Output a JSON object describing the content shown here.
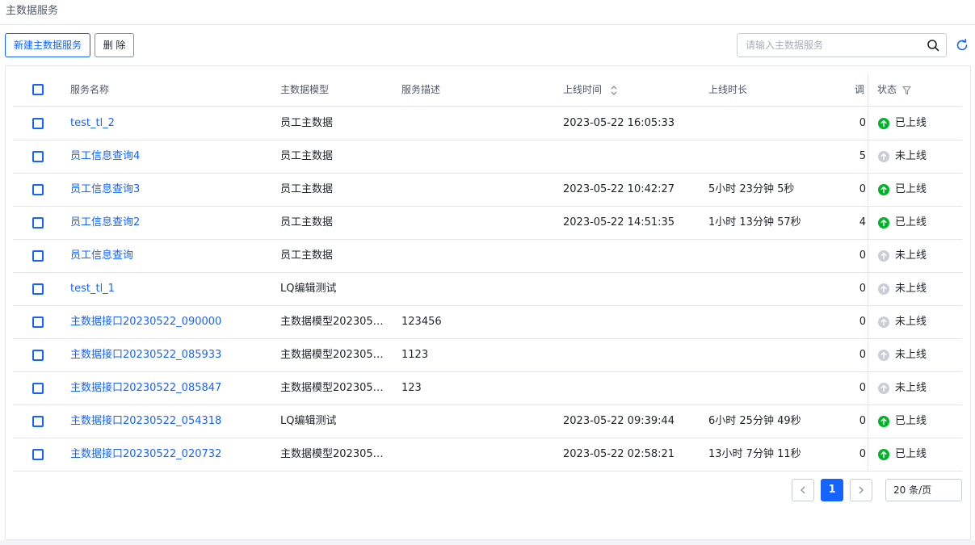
{
  "page": {
    "title": "主数据服务"
  },
  "toolbar": {
    "new_label": "新建主数据服务",
    "delete_label": "删 除"
  },
  "search": {
    "placeholder": "请输入主数据服务",
    "value": ""
  },
  "table": {
    "columns": {
      "name": "服务名称",
      "model": "主数据模型",
      "desc": "服务描述",
      "time": "上线时间",
      "duration": "上线时长",
      "calls": "调用",
      "status": "状态"
    },
    "rows": [
      {
        "name": "test_tl_2",
        "model": "员工主数据",
        "desc": "",
        "time": "2023-05-22 16:05:33",
        "duration": "",
        "calls": "0",
        "status": "已上线",
        "online": true
      },
      {
        "name": "员工信息查询4",
        "model": "员工主数据",
        "desc": "",
        "time": "",
        "duration": "",
        "calls": "5",
        "status": "未上线",
        "online": false
      },
      {
        "name": "员工信息查询3",
        "model": "员工主数据",
        "desc": "",
        "time": "2023-05-22 10:42:27",
        "duration": "5小时 23分钟 5秒",
        "calls": "0",
        "status": "已上线",
        "online": true
      },
      {
        "name": "员工信息查询2",
        "model": "员工主数据",
        "desc": "",
        "time": "2023-05-22 14:51:35",
        "duration": "1小时 13分钟 57秒",
        "calls": "4",
        "status": "已上线",
        "online": true
      },
      {
        "name": "员工信息查询",
        "model": "员工主数据",
        "desc": "",
        "time": "",
        "duration": "",
        "calls": "0",
        "status": "未上线",
        "online": false
      },
      {
        "name": "test_tl_1",
        "model": "LQ编辑测试",
        "desc": "",
        "time": "",
        "duration": "",
        "calls": "0",
        "status": "未上线",
        "online": false
      },
      {
        "name": "主数据接口20230522_090000",
        "model": "主数据模型202305…",
        "desc": "123456",
        "time": "",
        "duration": "",
        "calls": "0",
        "status": "未上线",
        "online": false
      },
      {
        "name": "主数据接口20230522_085933",
        "model": "主数据模型202305…",
        "desc": "1123",
        "time": "",
        "duration": "",
        "calls": "0",
        "status": "未上线",
        "online": false
      },
      {
        "name": "主数据接口20230522_085847",
        "model": "主数据模型202305…",
        "desc": "123",
        "time": "",
        "duration": "",
        "calls": "0",
        "status": "未上线",
        "online": false
      },
      {
        "name": "主数据接口20230522_054318",
        "model": "LQ编辑测试",
        "desc": "",
        "time": "2023-05-22 09:39:44",
        "duration": "6小时 25分钟 49秒",
        "calls": "0",
        "status": "已上线",
        "online": true
      },
      {
        "name": "主数据接口20230522_020732",
        "model": "主数据模型202305…",
        "desc": "",
        "time": "2023-05-22 02:58:21",
        "duration": "13小时 7分钟 11秒",
        "calls": "0",
        "status": "已上线",
        "online": true
      }
    ]
  },
  "pagination": {
    "current_page": "1",
    "page_size_label": "20 条/页"
  },
  "colors": {
    "accent": "#1664ff",
    "online": "#00b42a",
    "offline": "#c9cdd4"
  },
  "icons": {
    "search": "search-icon",
    "refresh": "refresh-icon",
    "sort": "sort-icon",
    "filter": "filter-icon",
    "online": "arrow-up-circle-icon",
    "offline": "arrow-up-circle-icon"
  }
}
